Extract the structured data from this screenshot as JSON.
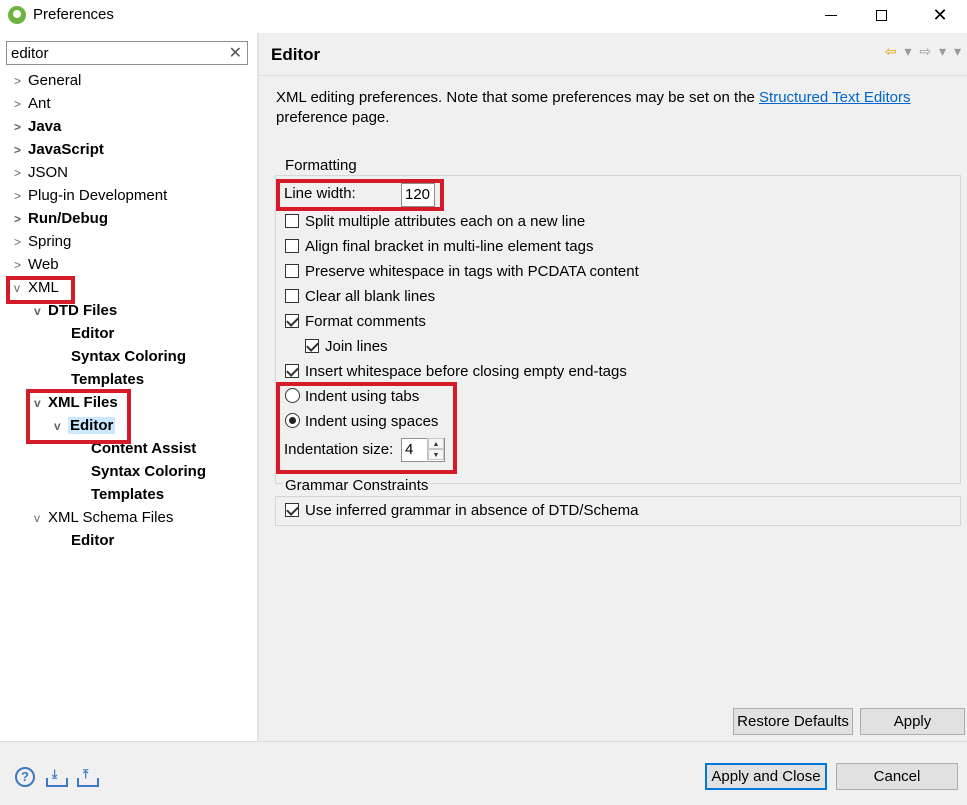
{
  "window": {
    "title": "Preferences",
    "min_glyph": "",
    "max_glyph": "",
    "close_glyph": "✕"
  },
  "filter": {
    "value": "editor",
    "clear_glyph": "✕"
  },
  "tree": [
    {
      "label": "General",
      "twisty": ">",
      "bold": false
    },
    {
      "label": "Ant",
      "twisty": ">",
      "bold": false
    },
    {
      "label": "Java",
      "twisty": ">",
      "bold": true
    },
    {
      "label": "JavaScript",
      "twisty": ">",
      "bold": true
    },
    {
      "label": "JSON",
      "twisty": ">",
      "bold": false
    },
    {
      "label": "Plug-in Development",
      "twisty": ">",
      "bold": false
    },
    {
      "label": "Run/Debug",
      "twisty": ">",
      "bold": true
    },
    {
      "label": "Spring",
      "twisty": ">",
      "bold": false
    },
    {
      "label": "Web",
      "twisty": ">",
      "bold": false
    },
    {
      "label": "XML",
      "twisty": "v",
      "bold": false
    },
    {
      "label": "DTD Files",
      "twisty": "v",
      "bold": true
    },
    {
      "label": "Editor",
      "twisty": "",
      "bold": true
    },
    {
      "label": "Syntax Coloring",
      "twisty": "",
      "bold": true
    },
    {
      "label": "Templates",
      "twisty": "",
      "bold": true
    },
    {
      "label": "XML Files",
      "twisty": "v",
      "bold": true
    },
    {
      "label": "Editor",
      "twisty": "v",
      "bold": true
    },
    {
      "label": "Content Assist",
      "twisty": "",
      "bold": true
    },
    {
      "label": "Syntax Coloring",
      "twisty": "",
      "bold": true
    },
    {
      "label": "Templates",
      "twisty": "",
      "bold": true
    },
    {
      "label": "XML Schema Files",
      "twisty": "v",
      "bold": false
    },
    {
      "label": "Editor",
      "twisty": "",
      "bold": true
    }
  ],
  "page": {
    "title": "Editor",
    "nav": {
      "back": "⇦",
      "drop1": "▾",
      "forward": "⇨",
      "drop2": "▾",
      "menu": "▾"
    },
    "description_pre": "XML editing preferences.  Note that some preferences may be set on the ",
    "description_link": "Structured Text Editors",
    "description_post": " preference page."
  },
  "formatting": {
    "group_label": "Formatting",
    "line_width_label": "Line width:",
    "line_width_value": "120",
    "checkboxes": [
      {
        "label": "Split multiple attributes each on a new line",
        "checked": false
      },
      {
        "label": "Align final bracket in multi-line element tags",
        "checked": false
      },
      {
        "label": "Preserve whitespace in tags with PCDATA content",
        "checked": false
      },
      {
        "label": "Clear all blank lines",
        "checked": false
      },
      {
        "label": "Format comments",
        "checked": true
      },
      {
        "label": "Join lines",
        "checked": true
      },
      {
        "label": "Insert whitespace before closing empty end-tags",
        "checked": true
      }
    ],
    "radios": [
      {
        "label": "Indent using tabs",
        "selected": false
      },
      {
        "label": "Indent using spaces",
        "selected": true
      }
    ],
    "indent_size_label": "Indentation size:",
    "indent_size_value": "4",
    "spin_up": "▲",
    "spin_down": "▼"
  },
  "grammar": {
    "group_label": "Grammar Constraints",
    "checkbox_label": "Use inferred grammar in absence of DTD/Schema",
    "checked": true
  },
  "buttons": {
    "restore_defaults": "Restore Defaults",
    "apply": "Apply",
    "apply_and_close": "Apply and Close",
    "cancel": "Cancel"
  },
  "bottom_icons": {
    "help": "?",
    "import": "⤓",
    "export": "⤒"
  },
  "colors": {
    "highlight_box": "#d51b28",
    "selection": "#cce8ff",
    "link": "#0066cc",
    "default_button_border": "#0078d7"
  }
}
